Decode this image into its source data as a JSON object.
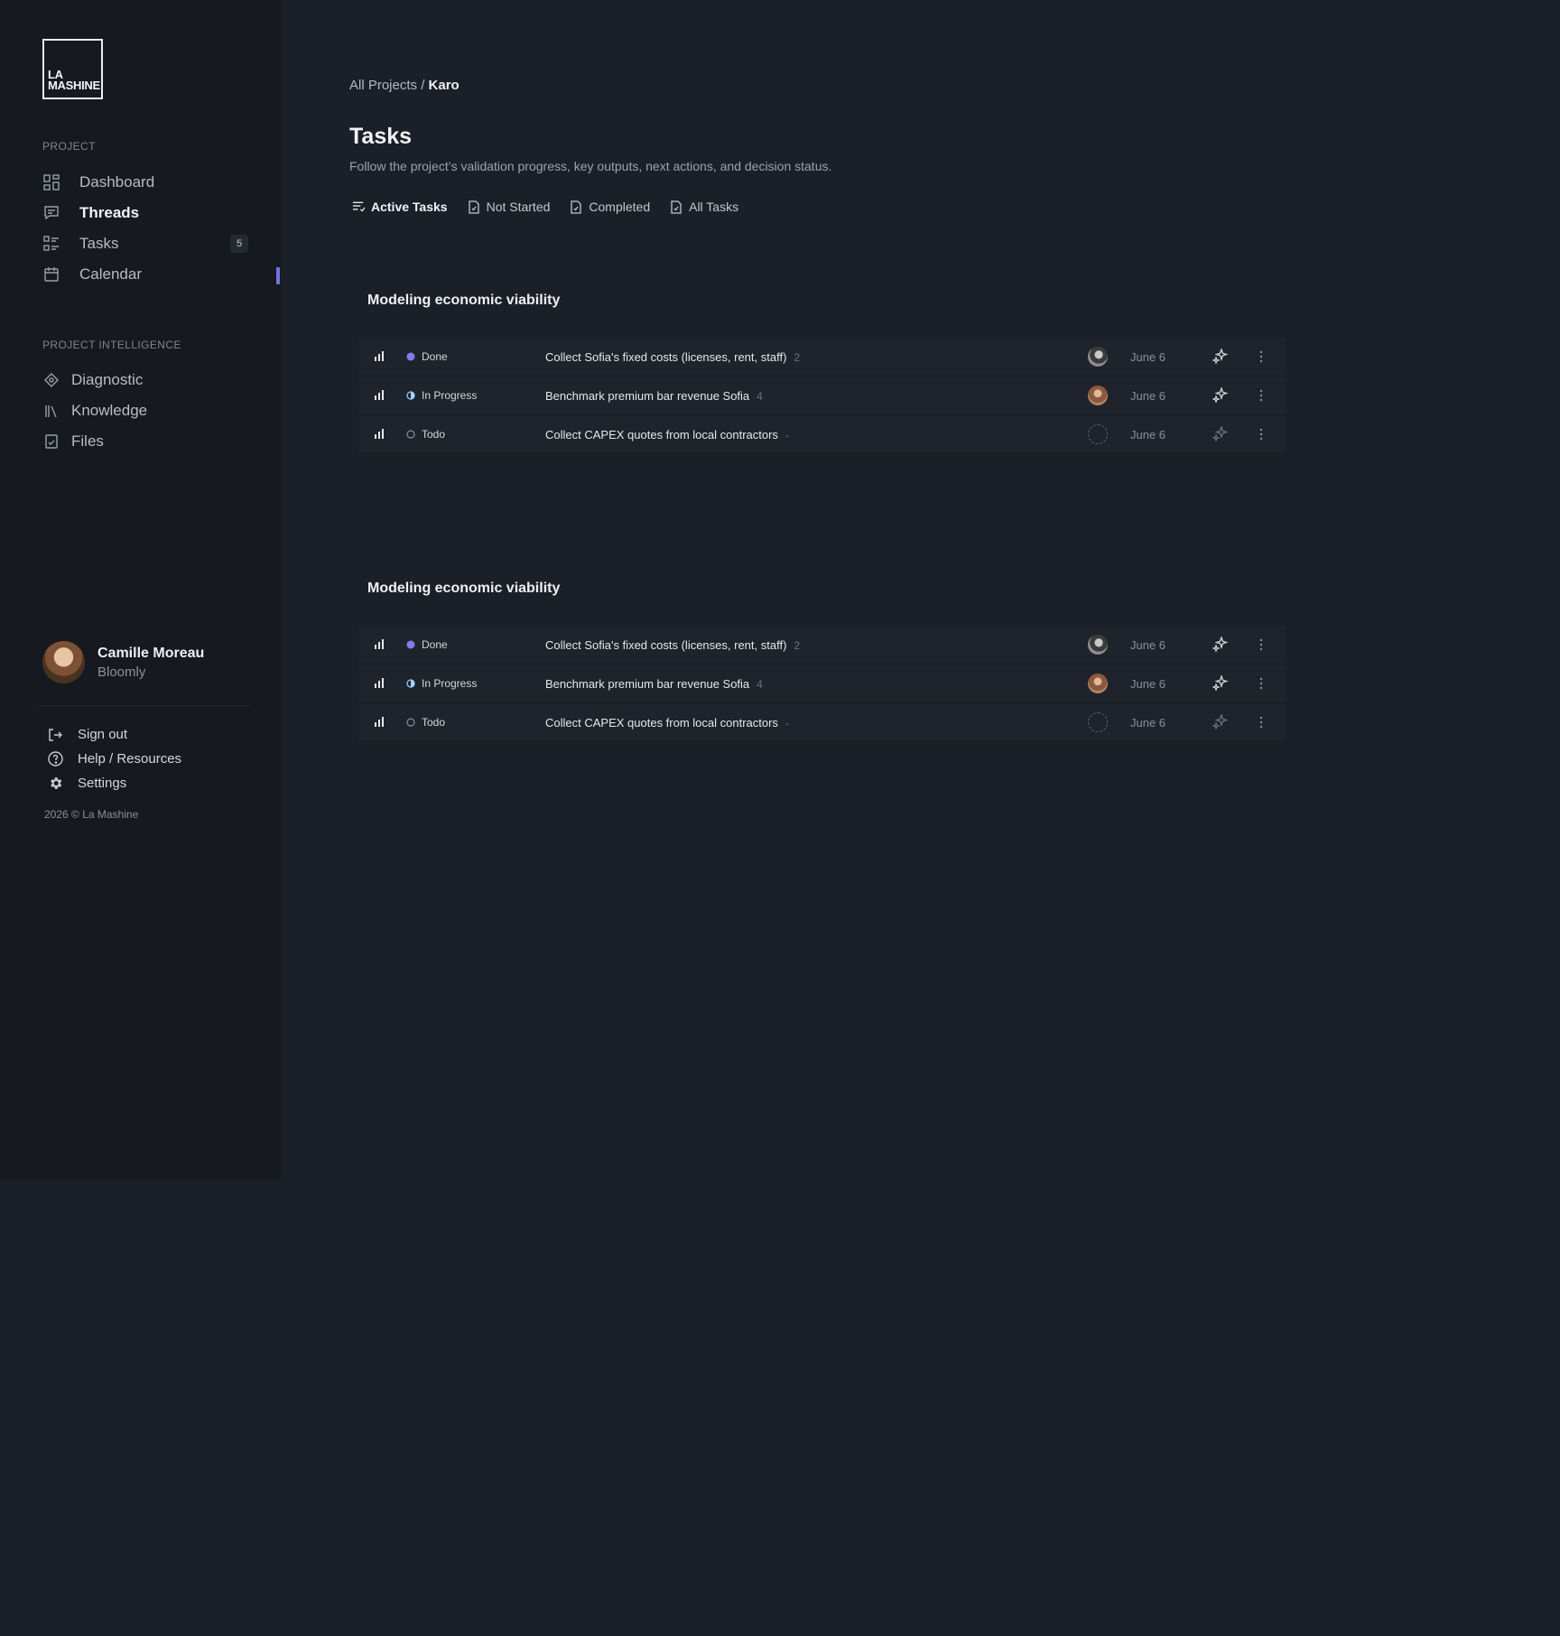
{
  "brand": {
    "logo_line1": "LA",
    "logo_line2": "MASHINE"
  },
  "sidebar": {
    "project_label": "PROJECT",
    "items": [
      {
        "label": "Dashboard",
        "icon": "dashboard-grid-icon"
      },
      {
        "label": "Threads",
        "icon": "chat-bubble-icon",
        "active": true
      },
      {
        "label": "Tasks",
        "icon": "task-list-icon",
        "badge": "5"
      },
      {
        "label": "Calendar",
        "icon": "calendar-icon"
      }
    ],
    "intel_label": "PROJECT INTELLIGENCE",
    "intel_items": [
      {
        "label": "Diagnostic",
        "icon": "diamond-icon"
      },
      {
        "label": "Knowledge",
        "icon": "books-icon"
      },
      {
        "label": "Files",
        "icon": "file-icon"
      }
    ],
    "user": {
      "name": "Camille Moreau",
      "org": "Bloomly"
    },
    "footer": [
      {
        "label": "Sign out",
        "icon": "sign-out-icon"
      },
      {
        "label": "Help / Resources",
        "icon": "help-circle-icon"
      },
      {
        "label": "Settings",
        "icon": "gear-icon"
      }
    ],
    "copyright": "2026 © La Mashine"
  },
  "main": {
    "breadcrumb": {
      "parent": "All Projects",
      "sep": " / ",
      "current": "Karo"
    },
    "title": "Tasks",
    "subtitle": "Follow the project’s validation progress, key outputs, next actions, and decision status.",
    "tabs": [
      {
        "label": "Active Tasks",
        "active": true
      },
      {
        "label": "Not Started"
      },
      {
        "label": "Completed"
      },
      {
        "label": "All Tasks"
      }
    ],
    "groups": [
      {
        "title": "Modeling economic viability",
        "rows": [
          {
            "status": "Done",
            "title": "Collect Sofia's fixed costs (licenses, rent, staff)",
            "count": "2",
            "date": "June 6"
          },
          {
            "status": "In Progress",
            "title": "Benchmark premium bar revenue Sofia",
            "count": "4",
            "date": "June 6"
          },
          {
            "status": "Todo",
            "title": "Collect CAPEX quotes from local contractors",
            "count": "-",
            "date": "June 6"
          }
        ]
      },
      {
        "title": "Modeling economic viability",
        "rows": [
          {
            "status": "Done",
            "title": "Collect Sofia's fixed costs (licenses, rent, staff)",
            "count": "2",
            "date": "June 6"
          },
          {
            "status": "In Progress",
            "title": "Benchmark premium bar revenue Sofia",
            "count": "4",
            "date": "June 6"
          },
          {
            "status": "Todo",
            "title": "Collect CAPEX quotes from local contractors",
            "count": "-",
            "date": "June 6"
          }
        ]
      }
    ]
  },
  "colors": {
    "accent": "#6f73e6",
    "background": "#1b1f27",
    "sidebar": "#16191f"
  }
}
